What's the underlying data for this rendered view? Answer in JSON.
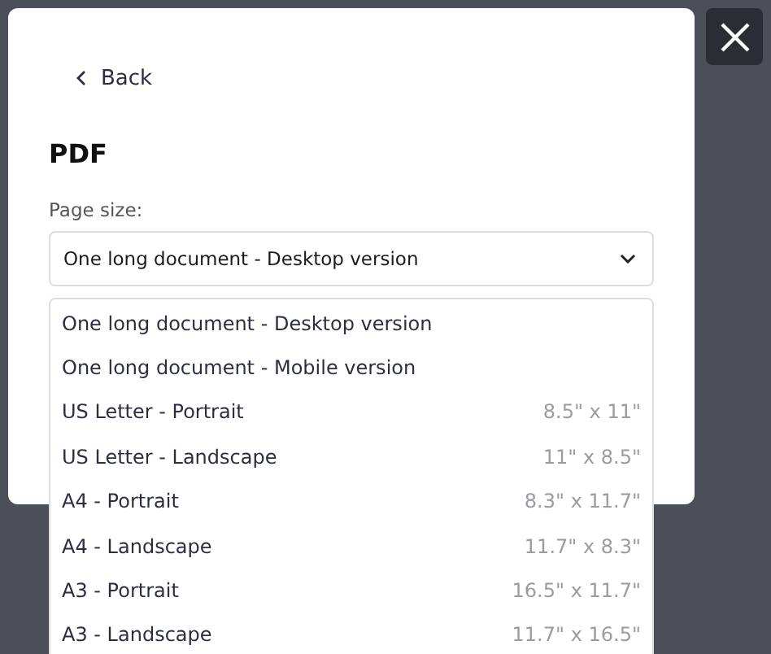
{
  "dialog": {
    "back_link": "Back",
    "title": "PDF",
    "field_label": "Page size:",
    "select_value": "One long document - Desktop version",
    "expanded": true
  },
  "options": [
    {
      "label": "One long document - Desktop version"
    },
    {
      "label": "One long document - Mobile version"
    },
    {
      "label": "US Letter - Portrait",
      "size": "8.5\" x 11\""
    },
    {
      "label": "US Letter - Landscape",
      "size": "11\" x 8.5\""
    },
    {
      "label": "A4 - Portrait",
      "size": "8.3\" x 11.7\""
    },
    {
      "label": "A4 - Landscape",
      "size": "11.7\" x 8.3\""
    },
    {
      "label": "A3 - Portrait",
      "size": "16.5\" x 11.7\""
    },
    {
      "label": "A3 - Landscape",
      "size": "11.7\" x 16.5\""
    }
  ]
}
